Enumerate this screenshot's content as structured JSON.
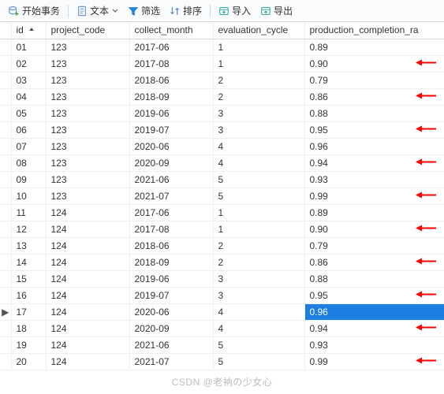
{
  "toolbar": {
    "start_tx": "开始事务",
    "text": "文本",
    "filter": "筛选",
    "sort": "排序",
    "import": "导入",
    "export": "导出"
  },
  "columns": {
    "id": "id",
    "project_code": "project_code",
    "collect_month": "collect_month",
    "evaluation_cycle": "evaluation_cycle",
    "production_completion_rate": "production_completion_ra"
  },
  "rows": [
    {
      "id": "01",
      "project_code": "123",
      "collect_month": "2017-06",
      "evaluation_cycle": "1",
      "rate": "0.89",
      "arrow": false,
      "selected": false,
      "cursor": false
    },
    {
      "id": "02",
      "project_code": "123",
      "collect_month": "2017-08",
      "evaluation_cycle": "1",
      "rate": "0.90",
      "arrow": true,
      "selected": false,
      "cursor": false
    },
    {
      "id": "03",
      "project_code": "123",
      "collect_month": "2018-06",
      "evaluation_cycle": "2",
      "rate": "0.79",
      "arrow": false,
      "selected": false,
      "cursor": false
    },
    {
      "id": "04",
      "project_code": "123",
      "collect_month": "2018-09",
      "evaluation_cycle": "2",
      "rate": "0.86",
      "arrow": true,
      "selected": false,
      "cursor": false
    },
    {
      "id": "05",
      "project_code": "123",
      "collect_month": "2019-06",
      "evaluation_cycle": "3",
      "rate": "0.88",
      "arrow": false,
      "selected": false,
      "cursor": false
    },
    {
      "id": "06",
      "project_code": "123",
      "collect_month": "2019-07",
      "evaluation_cycle": "3",
      "rate": "0.95",
      "arrow": true,
      "selected": false,
      "cursor": false
    },
    {
      "id": "07",
      "project_code": "123",
      "collect_month": "2020-06",
      "evaluation_cycle": "4",
      "rate": "0.96",
      "arrow": false,
      "selected": false,
      "cursor": false
    },
    {
      "id": "08",
      "project_code": "123",
      "collect_month": "2020-09",
      "evaluation_cycle": "4",
      "rate": "0.94",
      "arrow": true,
      "selected": false,
      "cursor": false
    },
    {
      "id": "09",
      "project_code": "123",
      "collect_month": "2021-06",
      "evaluation_cycle": "5",
      "rate": "0.93",
      "arrow": false,
      "selected": false,
      "cursor": false
    },
    {
      "id": "10",
      "project_code": "123",
      "collect_month": "2021-07",
      "evaluation_cycle": "5",
      "rate": "0.99",
      "arrow": true,
      "selected": false,
      "cursor": false
    },
    {
      "id": "11",
      "project_code": "124",
      "collect_month": "2017-06",
      "evaluation_cycle": "1",
      "rate": "0.89",
      "arrow": false,
      "selected": false,
      "cursor": false
    },
    {
      "id": "12",
      "project_code": "124",
      "collect_month": "2017-08",
      "evaluation_cycle": "1",
      "rate": "0.90",
      "arrow": true,
      "selected": false,
      "cursor": false
    },
    {
      "id": "13",
      "project_code": "124",
      "collect_month": "2018-06",
      "evaluation_cycle": "2",
      "rate": "0.79",
      "arrow": false,
      "selected": false,
      "cursor": false
    },
    {
      "id": "14",
      "project_code": "124",
      "collect_month": "2018-09",
      "evaluation_cycle": "2",
      "rate": "0.86",
      "arrow": true,
      "selected": false,
      "cursor": false
    },
    {
      "id": "15",
      "project_code": "124",
      "collect_month": "2019-06",
      "evaluation_cycle": "3",
      "rate": "0.88",
      "arrow": false,
      "selected": false,
      "cursor": false
    },
    {
      "id": "16",
      "project_code": "124",
      "collect_month": "2019-07",
      "evaluation_cycle": "3",
      "rate": "0.95",
      "arrow": true,
      "selected": false,
      "cursor": false
    },
    {
      "id": "17",
      "project_code": "124",
      "collect_month": "2020-06",
      "evaluation_cycle": "4",
      "rate": "0.96",
      "arrow": false,
      "selected": true,
      "cursor": true
    },
    {
      "id": "18",
      "project_code": "124",
      "collect_month": "2020-09",
      "evaluation_cycle": "4",
      "rate": "0.94",
      "arrow": true,
      "selected": false,
      "cursor": false
    },
    {
      "id": "19",
      "project_code": "124",
      "collect_month": "2021-06",
      "evaluation_cycle": "5",
      "rate": "0.93",
      "arrow": false,
      "selected": false,
      "cursor": false
    },
    {
      "id": "20",
      "project_code": "124",
      "collect_month": "2021-07",
      "evaluation_cycle": "5",
      "rate": "0.99",
      "arrow": true,
      "selected": false,
      "cursor": false
    }
  ],
  "watermark": "CSDN @老衲の少女心"
}
